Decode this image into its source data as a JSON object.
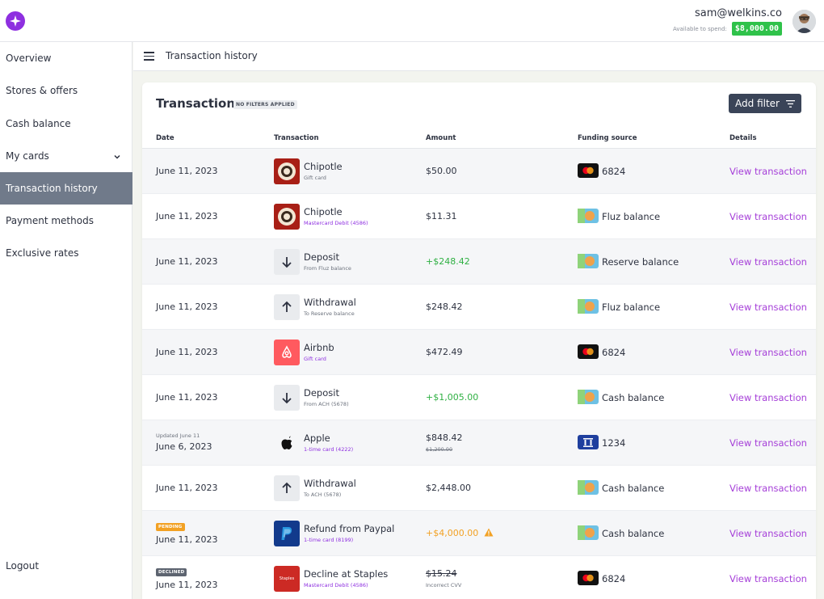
{
  "header": {
    "user_email": "sam@welkins.co",
    "spend_label": "Available to spend:",
    "spend_amount": "$8,000.00",
    "brand_color": "#8e2fe0",
    "spend_color": "#2fc24a"
  },
  "sidebar": {
    "items": [
      {
        "label": "Overview"
      },
      {
        "label": "Stores & offers"
      },
      {
        "label": "Cash balance"
      },
      {
        "label": "My cards"
      },
      {
        "label": "Transaction history"
      },
      {
        "label": "Payment methods"
      },
      {
        "label": "Exclusive rates"
      }
    ],
    "logout": "Logout",
    "active_item": "Transaction history"
  },
  "breadcrumb": {
    "title": "Transaction history"
  },
  "transactions": {
    "title": "Transactions",
    "filter_status": "NO FILTERS APPLIED",
    "add_filter": "Add filter",
    "columns": [
      "Date",
      "Transaction",
      "Amount",
      "Funding source",
      "Details"
    ],
    "rows": [
      {
        "date": "June 11, 2023",
        "name": "Chipotle",
        "sub": "Gift card",
        "amount": "$50.00",
        "funding": "6824",
        "details": "View transaction"
      },
      {
        "date": "June 11, 2023",
        "name": "Chipotle",
        "sub": "Mastercard Debit (4586)",
        "amount": "$11.31",
        "funding": "Fluz balance",
        "details": "View transaction"
      },
      {
        "date": "June 11, 2023",
        "name": "Deposit",
        "sub": "From Fluz balance",
        "amount": "+$248.42",
        "funding": "Reserve balance",
        "details": "View transaction"
      },
      {
        "date": "June 11, 2023",
        "name": "Withdrawal",
        "sub": "To Reserve balance",
        "amount": "$248.42",
        "funding": "Fluz balance",
        "details": "View transaction"
      },
      {
        "date": "June 11, 2023",
        "name": "Airbnb",
        "sub": "Gift card",
        "amount": "$472.49",
        "funding": "6824",
        "details": "View transaction"
      },
      {
        "date": "June 11, 2023",
        "name": "Deposit",
        "sub": "From ACH (5678)",
        "amount": "+$1,005.00",
        "funding": "Cash balance",
        "details": "View transaction"
      },
      {
        "date_note": "Updated June 11",
        "date": "June 6, 2023",
        "name": "Apple",
        "sub": "1-time card (4222)",
        "amount": "$848.42",
        "amount_sub": "$1,200.00",
        "funding": "1234",
        "details": "View transaction"
      },
      {
        "date": "June 11, 2023",
        "name": "Withdrawal",
        "sub": "To ACH (5678)",
        "amount": "$2,448.00",
        "funding": "Cash balance",
        "details": "View transaction"
      },
      {
        "badge": "PENDING",
        "date": "June 11, 2023",
        "name": "Refund from Paypal",
        "sub": "1-time card (8199)",
        "amount": "+$4,000.00",
        "funding": "Cash balance",
        "details": "View transaction"
      },
      {
        "badge": "DECLINED",
        "date": "June 11, 2023",
        "name": "Decline at Staples",
        "sub": "Mastercard Debit (4586)",
        "amount": "$15.24",
        "amount_sub": "Incorrect CVV",
        "funding": "6824",
        "details": "View transaction",
        "logo_text": "Staples"
      }
    ]
  }
}
